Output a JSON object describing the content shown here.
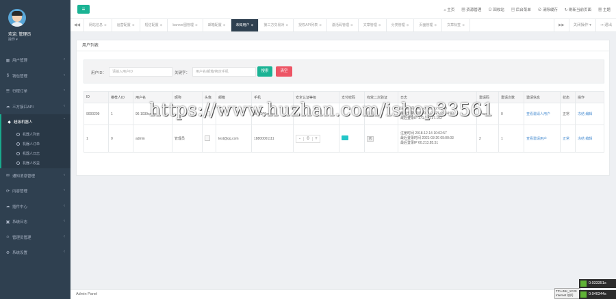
{
  "sidebar": {
    "welcome": "欢迎, 管理员",
    "role": "操作 ▾",
    "items": [
      {
        "icon": "▦",
        "label": "用户管理"
      },
      {
        "icon": "$",
        "label": "钱包管理"
      },
      {
        "icon": "☰",
        "label": "行程订单"
      },
      {
        "icon": "☁",
        "label": "三方接口API"
      },
      {
        "icon": "◆",
        "label": "超级机器人"
      }
    ],
    "sub_items": [
      "机器人列表",
      "机器人订单",
      "机器人日志",
      "机器人收益"
    ],
    "items2": [
      {
        "icon": "✉",
        "label": "通知消息管理"
      },
      {
        "icon": "⟳",
        "label": "内容管理"
      },
      {
        "icon": "☁",
        "label": "插件中心"
      },
      {
        "icon": "▣",
        "label": "系统日志"
      },
      {
        "icon": "☺",
        "label": "管理员管理"
      },
      {
        "icon": "⚙",
        "label": "系统设置"
      }
    ]
  },
  "topbar": {
    "menu_icon": "≡",
    "links": [
      "⌂ 主页",
      "▦ 资源管理",
      "⊙ 回收站",
      "▤ 后台菜单",
      "⊘ 清除缓存",
      "↻ 刷新当前页面",
      "▦ 主题"
    ]
  },
  "tabs": {
    "prev": "◀◀",
    "items": [
      "网站信息",
      "运营配置",
      "短信配置",
      "banner图管理",
      "邮箱配置",
      "未知用户",
      "第三方交易对",
      "授权API列表",
      "激活码管理",
      "文章管理",
      "分类管理",
      "页面管理",
      "文章标签"
    ],
    "active_index": 5,
    "next": "▶▶",
    "close_ops": "关闭操作 ▾",
    "logout": "⇥ 退出"
  },
  "panel": {
    "title": "用户列表",
    "search": {
      "uid_label": "用户ID：",
      "uid_placeholder": "请输入用户ID",
      "keyword_label": "关键字：",
      "keyword_placeholder": "用户名/邮箱/绑定手机",
      "search_btn": "搜索",
      "reset_btn": "清空"
    },
    "columns": [
      "ID",
      "推荐人ID",
      "用户名",
      "昵称",
      "头像",
      "邮箱",
      "手机",
      "安全认证等级",
      "支付密码",
      "有效二次验证",
      "日志",
      "邀请码",
      "邀请次数",
      "邀请信息",
      "状态",
      "操作"
    ],
    "rows": [
      {
        "id": "9000209",
        "ref": "1",
        "username": "96 1039xxxxx",
        "nick": "",
        "email": "",
        "phone": "96 1039xxxxx",
        "level": "",
        "log": "注册时间 2021-03-01 12:00:00\n最后登录时间 2021-03-26 09:14:30\n最后登录IP 171.100.37.102",
        "code": "1 nzctr",
        "invites": "0",
        "info": "查看邀请人用户",
        "status": "正常",
        "ops": "冻结 编辑"
      },
      {
        "id": "1",
        "ref": "0",
        "username": "admin",
        "nick": "管理员",
        "email": "test@qq.com",
        "phone": "18800001111",
        "level": "0",
        "log": "注册时间 2018-12-14 10:02:57\n最后登录时间 2021-03-26 09:00:03\n最后登录IP 60.213.85.51",
        "code": "2",
        "invites": "1",
        "info": "查看邀请用户",
        "status": "正常",
        "ops": "冻结 编辑"
      }
    ]
  },
  "watermark": "https://www.huzhan.com/ishop33561",
  "footer": "Admin Panel",
  "badges": [
    "0.033351s",
    "0.040344s"
  ],
  "tplink": "TP-LINK_1C20\nInternet 访问"
}
